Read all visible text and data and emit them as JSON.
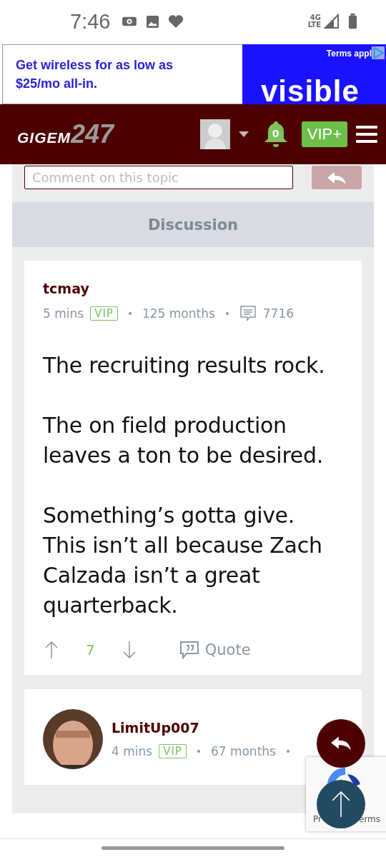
{
  "status_bar": {
    "time": "7:46",
    "network": "4G LTE"
  },
  "ad": {
    "text": "Get wireless for as low as $25/mo all-in.",
    "terms": "Terms appl",
    "brand": "visible"
  },
  "header": {
    "logo_word": "GIGEM",
    "logo_number": "247",
    "notifications": "0",
    "vip_button": "VIP+"
  },
  "comment_box": {
    "placeholder": "Comment on this topic"
  },
  "section_title": "Discussion",
  "posts": [
    {
      "author": "tcmay",
      "time": "5 mins",
      "badge": "VIP",
      "tenure": "125 months",
      "post_count": "7716",
      "avatar": false,
      "body": [
        "The recruiting results rock.",
        "The on field production leaves a ton to be desired.",
        "Something’s gotta give. This isn’t all because Zach Calzada isn’t a great quarterback."
      ],
      "votes": "7",
      "quote": "Quote"
    },
    {
      "author": "LimitUp007",
      "time": "4 mins",
      "badge": "VIP",
      "tenure": "67 months",
      "avatar": true
    }
  ],
  "recaptcha": {
    "left": "Pr",
    "right": "erms"
  }
}
